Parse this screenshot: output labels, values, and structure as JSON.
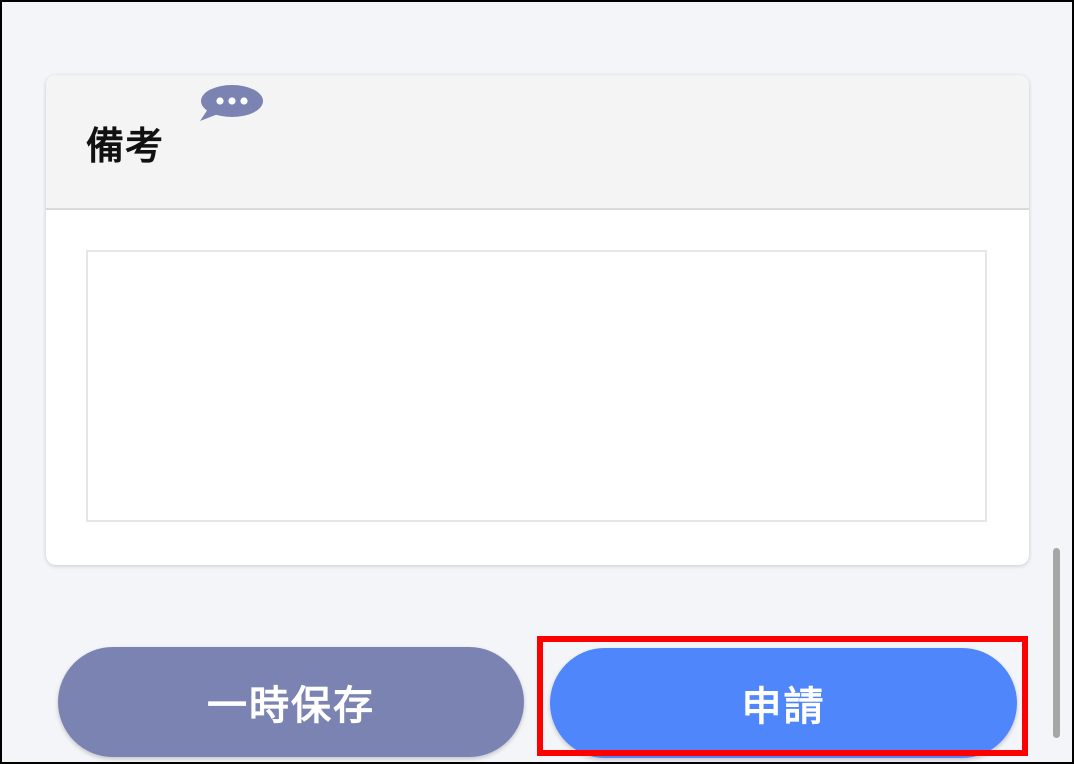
{
  "remarks": {
    "title": "備考",
    "comment_icon": "speech-bubble-ellipsis-icon",
    "textarea_value": ""
  },
  "buttons": {
    "save_draft_label": "一時保存",
    "apply_label": "申請"
  },
  "colors": {
    "save_button": "#7b83b2",
    "apply_button": "#4f86fb",
    "highlight": "#ff0000",
    "comment_icon": "#7b83b2"
  }
}
